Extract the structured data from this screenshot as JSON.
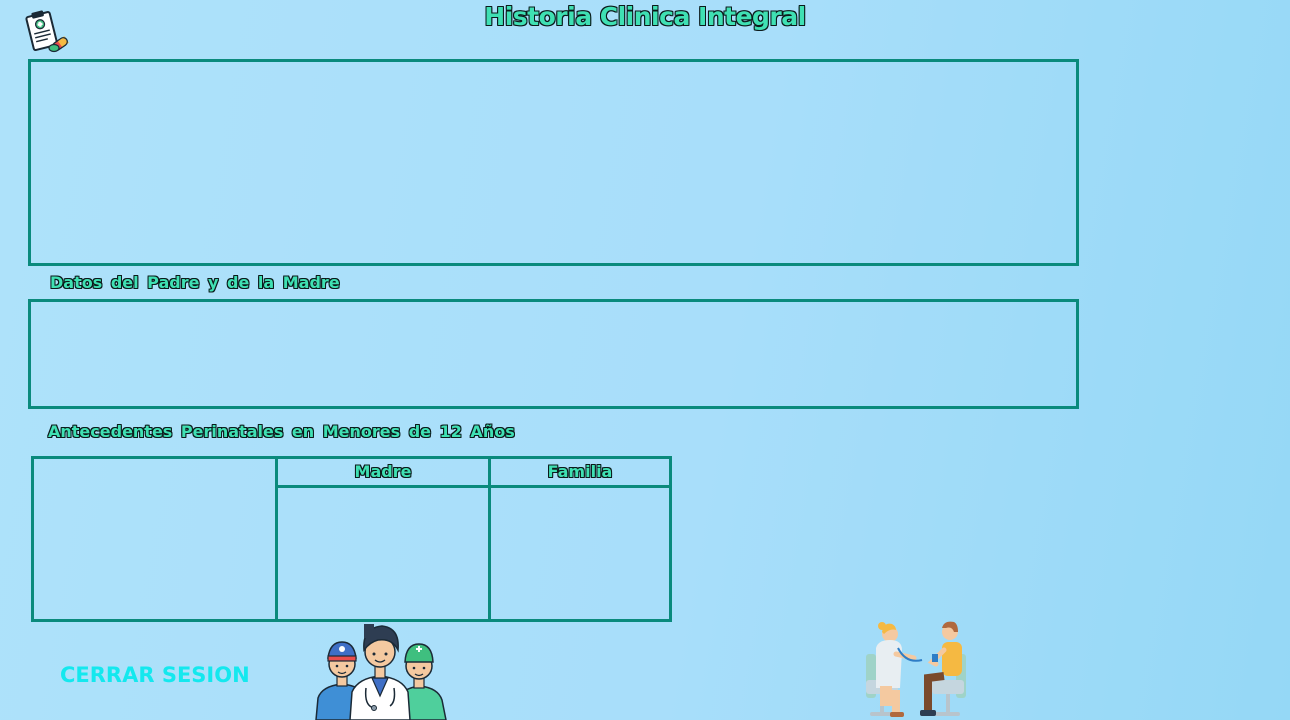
{
  "header": {
    "title": "Historia Clinica Integral",
    "logo_icon": "medical-record-icon"
  },
  "sections": {
    "parents_heading": "Datos del Padre y de la Madre",
    "perinatal_heading": "Antecedentes Perinatales en Menores de 12 Años"
  },
  "perinatal_table": {
    "columns": [
      "",
      "Madre",
      "Familia"
    ]
  },
  "actions": {
    "logout_label": "CERRAR SESION"
  },
  "illustrations": {
    "doctors": "medical-team-icon",
    "consultation": "doctor-patient-icon"
  },
  "colors": {
    "accent": "#3fe0b3",
    "border": "#0a8a7c",
    "logout": "#14e8ee",
    "background": "#aee2fa"
  }
}
